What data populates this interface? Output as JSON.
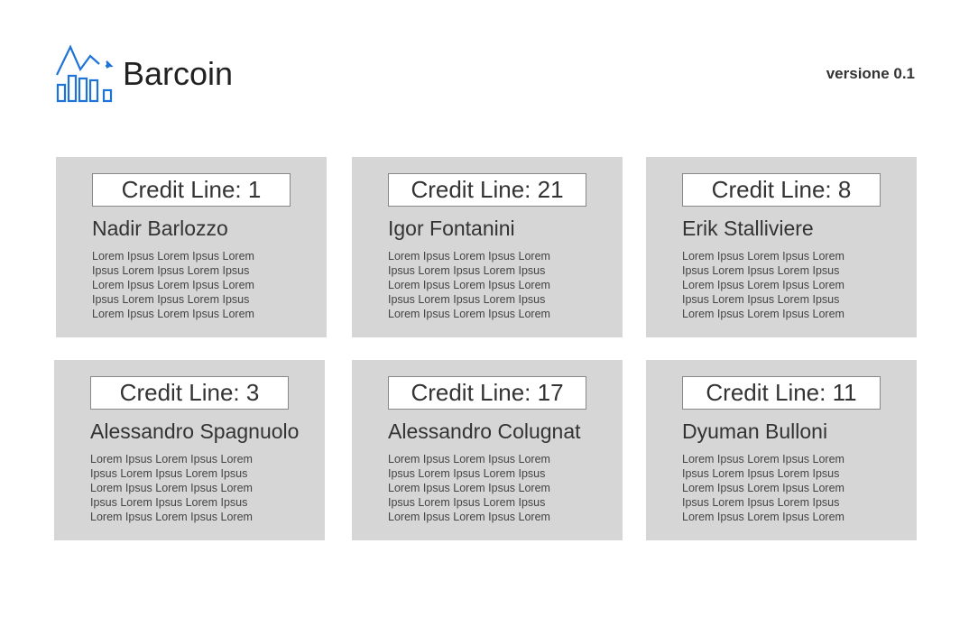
{
  "header": {
    "title": "Barcoin",
    "version": "versione 0.1",
    "logo_icon": "bar-chart-trend-icon",
    "accent_color": "#1e73d8"
  },
  "cards": [
    {
      "credit_line": "Credit Line: 1",
      "name": "Nadir Barlozzo",
      "description": "Lorem Ipsus Lorem Ipsus Lorem Ipsus Lorem Ipsus Lorem Ipsus Lorem Ipsus Lorem Ipsus Lorem Ipsus Lorem Ipsus Lorem Ipsus Lorem Ipsus Lorem Ipsus Lorem"
    },
    {
      "credit_line": "Credit Line: 21",
      "name": "Igor Fontanini",
      "description": "Lorem Ipsus Lorem Ipsus Lorem Ipsus Lorem Ipsus Lorem Ipsus Lorem Ipsus Lorem Ipsus Lorem Ipsus Lorem Ipsus Lorem Ipsus Lorem Ipsus Lorem Ipsus Lorem"
    },
    {
      "credit_line": "Credit Line: 8",
      "name": "Erik Stalliviere",
      "description": "Lorem Ipsus Lorem Ipsus Lorem Ipsus Lorem Ipsus Lorem Ipsus Lorem Ipsus Lorem Ipsus Lorem Ipsus Lorem Ipsus Lorem Ipsus Lorem Ipsus Lorem Ipsus Lorem"
    },
    {
      "credit_line": "Credit Line: 3",
      "name": "Alessandro Spagnuolo",
      "description": "Lorem Ipsus Lorem Ipsus Lorem Ipsus Lorem Ipsus Lorem Ipsus Lorem Ipsus Lorem Ipsus Lorem Ipsus Lorem Ipsus Lorem Ipsus Lorem Ipsus Lorem Ipsus Lorem"
    },
    {
      "credit_line": "Credit Line: 17",
      "name": "Alessandro Colugnat",
      "description": "Lorem Ipsus Lorem Ipsus Lorem Ipsus Lorem Ipsus Lorem Ipsus Lorem Ipsus Lorem Ipsus Lorem Ipsus Lorem Ipsus Lorem Ipsus Lorem Ipsus Lorem Ipsus Lorem"
    },
    {
      "credit_line": "Credit Line: 11",
      "name": "Dyuman Bulloni",
      "description": "Lorem Ipsus Lorem Ipsus Lorem Ipsus Lorem Ipsus Lorem Ipsus Lorem Ipsus Lorem Ipsus Lorem Ipsus Lorem Ipsus Lorem Ipsus Lorem Ipsus Lorem Ipsus Lorem"
    }
  ]
}
